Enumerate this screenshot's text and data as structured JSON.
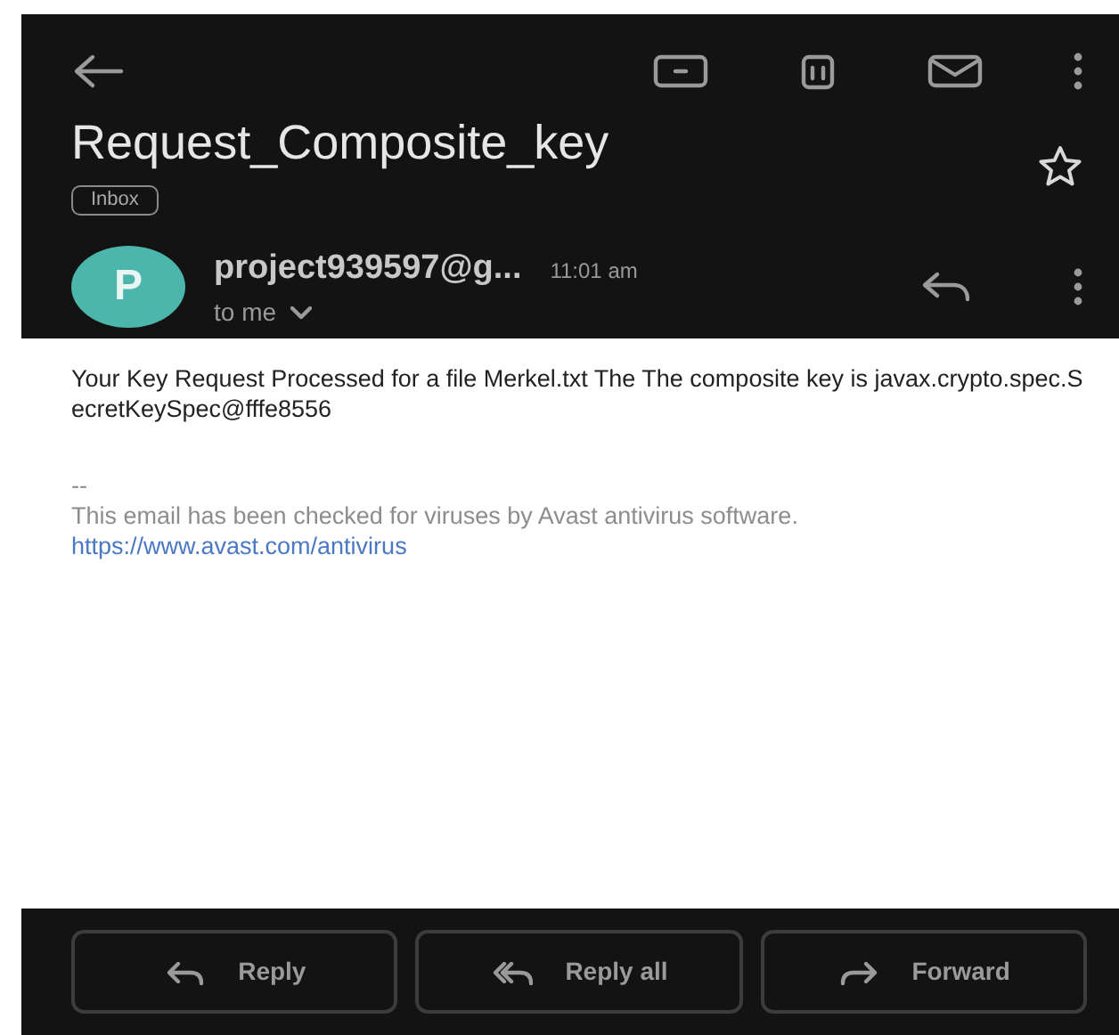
{
  "subject": "Request_Composite_key",
  "label": "Inbox",
  "starred": false,
  "sender": {
    "initial": "P",
    "color": "#4db6ac",
    "address": "project939597@g...",
    "time": "11:01 am",
    "recipient": "to me"
  },
  "body": {
    "message": "Your Key Request Processed for a file Merkel.txt  The The composite key is javax.crypto.spec.SecretKeySpec@fffe8556",
    "separator": "--",
    "signature": "This email has been checked for viruses by Avast antivirus software.",
    "link": "https://www.avast.com/antivirus"
  },
  "actions": [
    {
      "kind": "reply",
      "label": "Reply"
    },
    {
      "kind": "reply-all",
      "label": "Reply all"
    },
    {
      "kind": "forward",
      "label": "Forward"
    }
  ]
}
